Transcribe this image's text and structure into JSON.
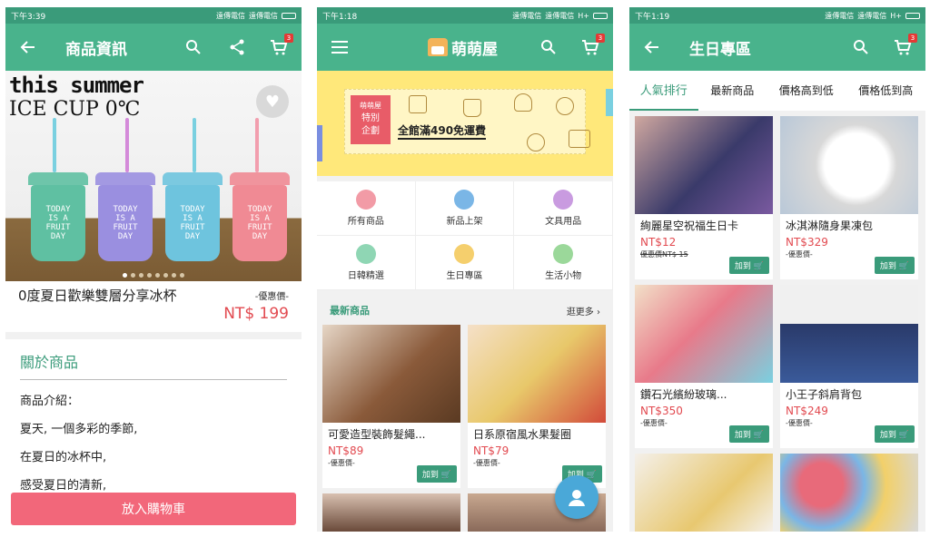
{
  "colors": {
    "primary": "#49b38c",
    "status": "#3a9b7a",
    "price": "#e24a50",
    "cta": "#f2677a",
    "fab": "#4aa8d8"
  },
  "status_bar": [
    {
      "time": "下午3:39",
      "carrier1": "遠傳電信",
      "carrier2": "遠傳電信"
    },
    {
      "time": "下午1:18",
      "carrier1": "遠傳電信",
      "carrier2": "遠傳電信",
      "net": "H+"
    },
    {
      "time": "下午1:19",
      "carrier1": "遠傳電信",
      "carrier2": "遠傳電信",
      "net": "H+"
    }
  ],
  "cart_count": "3",
  "phone1": {
    "title": "商品資訊",
    "hero_headline": "this summer",
    "hero_sub": "ICE CUP 0℃",
    "cup_text": "TODAY\nIS A\nFRUIT\nDAY",
    "product_name": "0度夏日歡樂雙層分享冰杯",
    "price_label": "-優惠價-",
    "price": "NT$ 199",
    "about_title": "關於商品",
    "description": [
      "商品介紹：",
      "夏天, 一個多彩的季節,",
      "在夏日的冰杯中,",
      "感受夏日的清新,"
    ],
    "cta": "放入購物車"
  },
  "phone2": {
    "title": "萌萌屋",
    "banner_tag": [
      "萌萌屋",
      "特別",
      "企劃"
    ],
    "banner_text": "全館滿490免運費",
    "categories": [
      "所有商品",
      "新品上架",
      "文具用品",
      "日韓精選",
      "生日專區",
      "生活小物"
    ],
    "section_title": "最新商品",
    "section_more": "逛更多",
    "products": [
      {
        "name": "可愛造型裝飾髮繩...",
        "price": "NT$89",
        "discount": "-優惠價-",
        "add": "加到"
      },
      {
        "name": "日系原宿風水果髮圈",
        "price": "NT$79",
        "discount": "-優惠價-",
        "add": "加到"
      }
    ]
  },
  "phone3": {
    "title": "生日專區",
    "tabs": [
      "人氣排行",
      "最新商品",
      "價格高到低",
      "價格低到高"
    ],
    "products": [
      {
        "name": "絢麗星空祝福生日卡",
        "price": "NT$12",
        "discount": "優惠價NT$ 15",
        "add": "加到"
      },
      {
        "name": "冰淇淋隨身果凍包",
        "price": "NT$329",
        "discount": "-優惠價-",
        "add": "加到"
      },
      {
        "name": "鑽石光繽紛玻璃...",
        "price": "NT$350",
        "discount": "-優惠價-",
        "add": "加到"
      },
      {
        "name": "小王子斜肩背包",
        "price": "NT$249",
        "discount": "-優惠價-",
        "add": "加到"
      }
    ]
  }
}
